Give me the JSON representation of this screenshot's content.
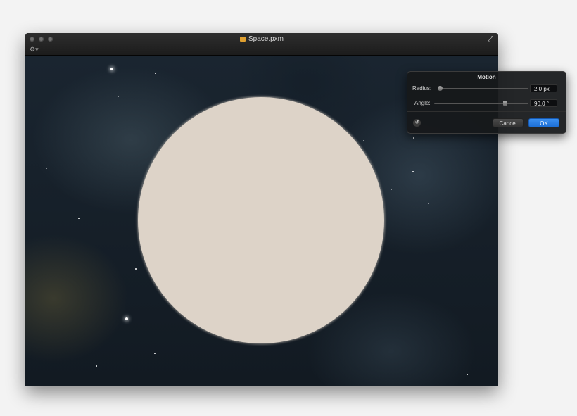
{
  "window": {
    "title": "Space.pxm",
    "doc_icon": "pixelmator-document-icon",
    "gear_glyph": "⚙▾",
    "fullscreen_glyph": "⤢"
  },
  "canvas": {
    "planet_color": "#ddd3c8"
  },
  "hud": {
    "title": "Motion",
    "radius_label": "Radius:",
    "radius_value": "2.0 px",
    "radius_level": 0.02,
    "angle_label": "Angle:",
    "angle_value": "90.0 °",
    "angle_level": 0.75,
    "reset_glyph": "↺",
    "cancel_label": "Cancel",
    "ok_label": "OK",
    "accent_color": "#2a7de6"
  }
}
